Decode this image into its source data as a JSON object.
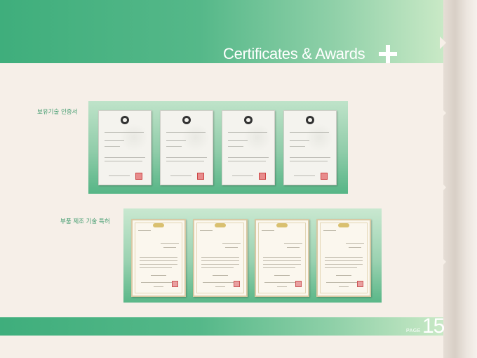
{
  "header": {
    "title": "Certificates & Awards"
  },
  "sections": [
    {
      "label": "보유기술 인증서",
      "certificates": 4
    },
    {
      "label": "부품 제조 기술 특허",
      "certificates": 4
    }
  ],
  "footer": {
    "page_word": "PAGE",
    "page_number": "15"
  },
  "colors": {
    "accent": "#3fae7c",
    "accent_light": "#c9e9c6",
    "background": "#f6efe8",
    "label": "#3f9a6c"
  },
  "icons": [
    "plus-icon",
    "certificate-document",
    "patent-document"
  ]
}
